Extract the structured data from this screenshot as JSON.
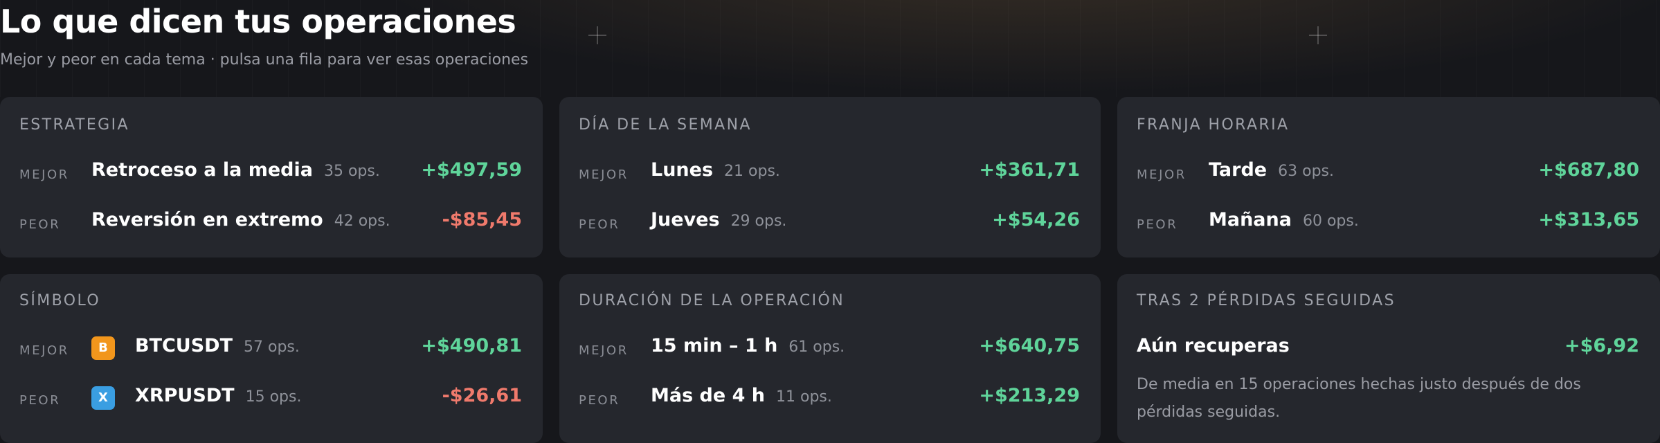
{
  "header": {
    "title": "Lo que dicen tus operaciones",
    "subtitle": "Mejor y peor en cada tema · pulsa una fila para ver esas operaciones"
  },
  "colors": {
    "positive": "#5fd49a",
    "negative": "#f07a6c",
    "card_bg": "#25272d",
    "page_bg": "#16171b",
    "btc_badge": "#f2961c",
    "xrp_badge": "#3a9ee2"
  },
  "cards": {
    "estrategia": {
      "title": "ESTRATEGIA",
      "best": {
        "tag": "MEJOR",
        "name": "Retroceso a la media",
        "count": "35 ops.",
        "value": "+$497,59"
      },
      "worst": {
        "tag": "PEOR",
        "name": "Reversión en extremo",
        "count": "42 ops.",
        "value": "-$85,45"
      }
    },
    "dia": {
      "title": "DÍA DE LA SEMANA",
      "best": {
        "tag": "MEJOR",
        "name": "Lunes",
        "count": "21 ops.",
        "value": "+$361,71"
      },
      "worst": {
        "tag": "PEOR",
        "name": "Jueves",
        "count": "29 ops.",
        "value": "+$54,26"
      }
    },
    "franja": {
      "title": "FRANJA HORARIA",
      "best": {
        "tag": "MEJOR",
        "name": "Tarde",
        "count": "63 ops.",
        "value": "+$687,80"
      },
      "worst": {
        "tag": "PEOR",
        "name": "Mañana",
        "count": "60 ops.",
        "value": "+$313,65"
      }
    },
    "simbolo": {
      "title": "SÍMBOLO",
      "best": {
        "tag": "MEJOR",
        "badge": "B",
        "icon": "bitcoin-icon",
        "name": "BTCUSDT",
        "count": "57 ops.",
        "value": "+$490,81"
      },
      "worst": {
        "tag": "PEOR",
        "badge": "X",
        "icon": "xrp-icon",
        "name": "XRPUSDT",
        "count": "15 ops.",
        "value": "-$26,61"
      }
    },
    "duracion": {
      "title": "DURACIÓN DE LA OPERACIÓN",
      "best": {
        "tag": "MEJOR",
        "name": "15 min – 1 h",
        "count": "61 ops.",
        "value": "+$640,75"
      },
      "worst": {
        "tag": "PEOR",
        "name": "Más de 4 h",
        "count": "11 ops.",
        "value": "+$213,29"
      }
    },
    "perdidas": {
      "title": "TRAS 2 PÉRDIDAS SEGUIDAS",
      "headline": "Aún recuperas",
      "value": "+$6,92",
      "description": "De media en 15 operaciones hechas justo después de dos pérdidas seguidas."
    }
  }
}
